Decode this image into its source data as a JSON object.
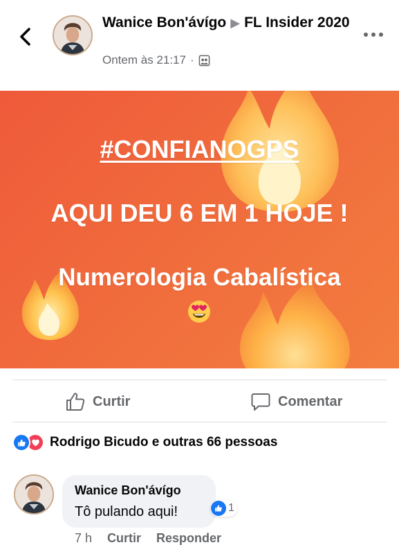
{
  "header": {
    "author": "Wanice Bon'ávígo",
    "arrow": "▶",
    "group": "FL Insider 2020",
    "timestamp": "Ontem às 21:17",
    "separator": "·"
  },
  "post_image": {
    "hashtag": "#CONFIANOGPS",
    "line2": "AQUI DEU 6 EM 1 HOJE !",
    "line3": "Numerologia Cabalística",
    "emoji": "heart-eyes-emoji"
  },
  "actions": {
    "like_label": "Curtir",
    "comment_label": "Comentar"
  },
  "reactions": {
    "summary": "Rodrigo Bicudo e outras 66 pessoas",
    "icons": [
      "like-icon",
      "love-icon"
    ]
  },
  "comment": {
    "author": "Wanice Bon'ávígo",
    "text": "Tô pulando aqui!",
    "reaction_count": "1",
    "time": "7 h",
    "like_label": "Curtir",
    "reply_label": "Responder"
  },
  "colors": {
    "brand_blue": "#1877f2",
    "love_red": "#f33e58",
    "post_bg": "#f06a3c",
    "muted_text": "#65676b"
  }
}
